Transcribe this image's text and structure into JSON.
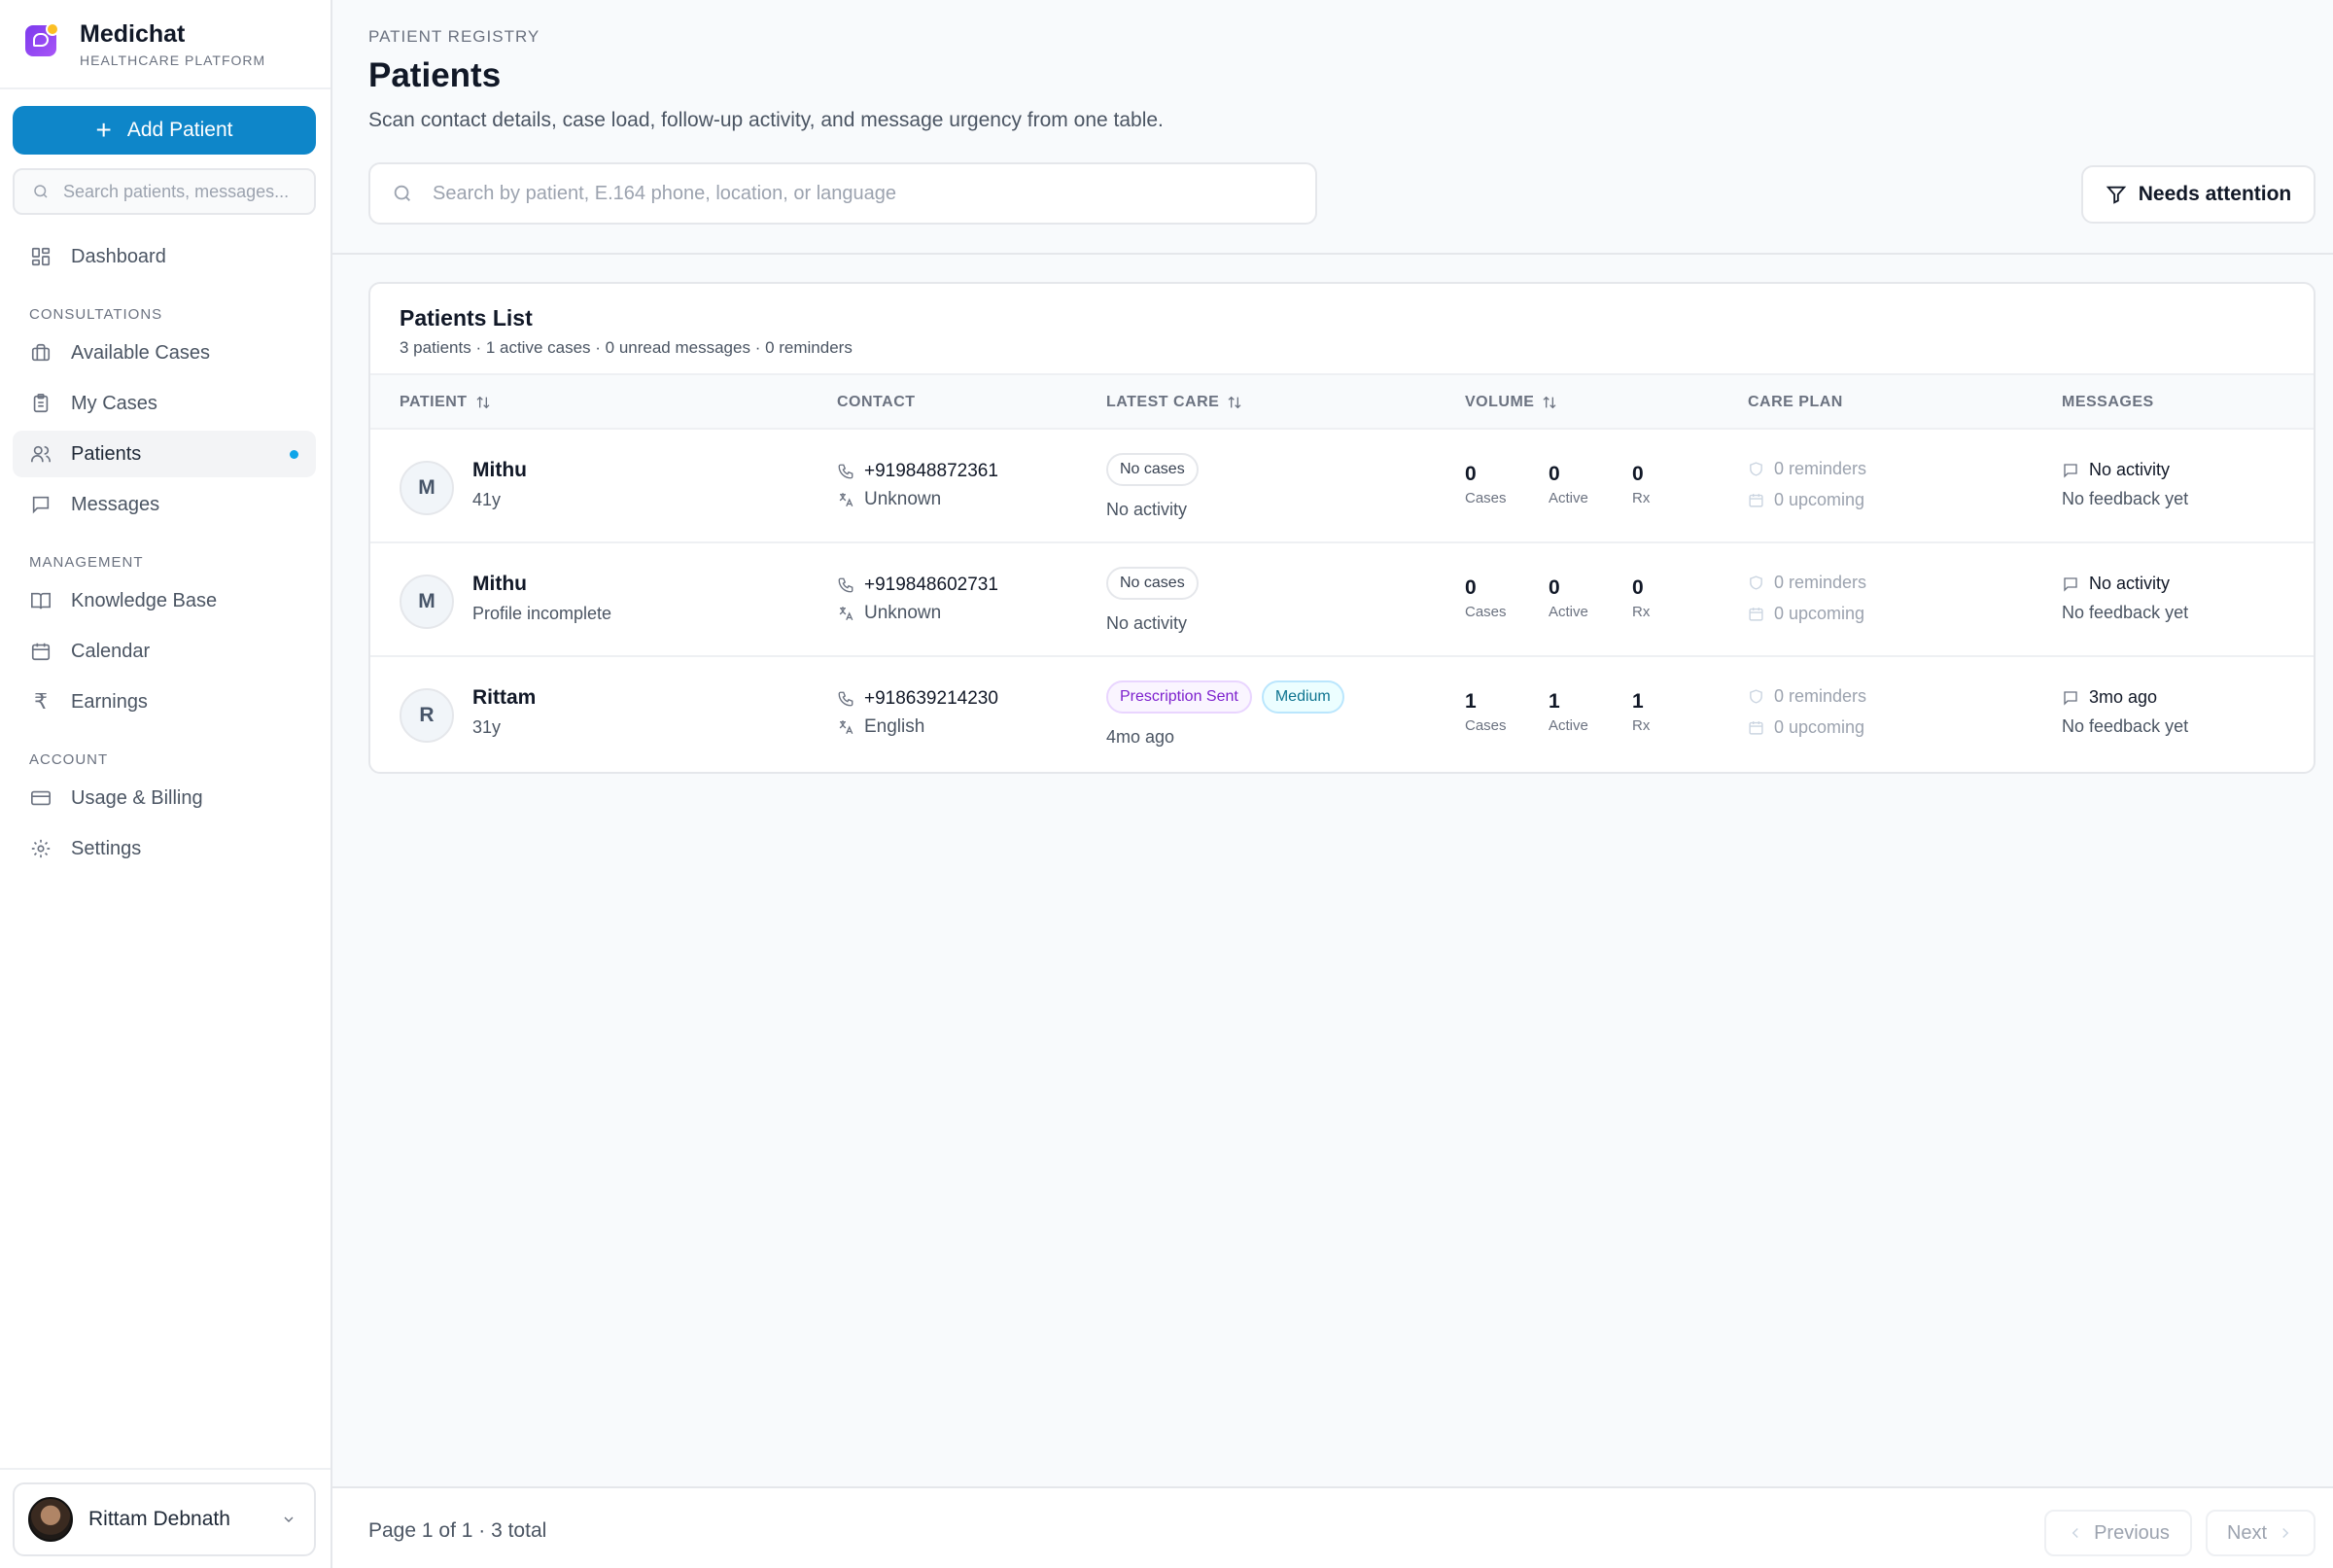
{
  "brand": {
    "name": "Medichat",
    "subtitle": "HEALTHCARE PLATFORM"
  },
  "sidebar": {
    "add_label": "Add Patient",
    "search_placeholder": "Search patients, messages...",
    "dashboard": "Dashboard",
    "sections": {
      "consultations": "CONSULTATIONS",
      "management": "MANAGEMENT",
      "account": "ACCOUNT"
    },
    "items": {
      "available_cases": "Available Cases",
      "my_cases": "My Cases",
      "patients": "Patients",
      "messages": "Messages",
      "knowledge_base": "Knowledge Base",
      "calendar": "Calendar",
      "earnings": "Earnings",
      "usage_billing": "Usage & Billing",
      "settings": "Settings"
    },
    "active_item": "Patients",
    "user_name": "Rittam Debnath"
  },
  "header": {
    "eyebrow": "PATIENT REGISTRY",
    "title": "Patients",
    "description": "Scan contact details, case load, follow-up activity, and message urgency from one table.",
    "search_placeholder": "Search by patient, E.164 phone, location, or language",
    "filter_label": "Needs attention"
  },
  "table": {
    "title": "Patients List",
    "summary": "3 patients · 1 active cases · 0 unread messages · 0 reminders",
    "columns": {
      "patient": "PATIENT",
      "contact": "CONTACT",
      "latest_care": "LATEST CARE",
      "volume": "VOLUME",
      "care_plan": "CARE PLAN",
      "messages": "MESSAGES"
    },
    "rows": [
      {
        "initial": "M",
        "name": "Mithu",
        "meta": "41y",
        "phone": "+919848872361",
        "language": "Unknown",
        "badge1": "No cases",
        "badge2": "",
        "last_care": "No activity",
        "cases": "0",
        "cases_label": "Cases",
        "active": "0",
        "active_label": "Active",
        "rx": "0",
        "rx_label": "Rx",
        "reminders": "0 reminders",
        "upcoming": "0 upcoming",
        "msg_activity": "No activity",
        "feedback": "No feedback yet"
      },
      {
        "initial": "M",
        "name": "Mithu",
        "meta": "Profile incomplete",
        "phone": "+919848602731",
        "language": "Unknown",
        "badge1": "No cases",
        "badge2": "",
        "last_care": "No activity",
        "cases": "0",
        "cases_label": "Cases",
        "active": "0",
        "active_label": "Active",
        "rx": "0",
        "rx_label": "Rx",
        "reminders": "0 reminders",
        "upcoming": "0 upcoming",
        "msg_activity": "No activity",
        "feedback": "No feedback yet"
      },
      {
        "initial": "R",
        "name": "Rittam",
        "meta": "31y",
        "phone": "+918639214230",
        "language": "English",
        "badge1": "Prescription Sent",
        "badge2": "Medium",
        "last_care": "4mo ago",
        "cases": "1",
        "cases_label": "Cases",
        "active": "1",
        "active_label": "Active",
        "rx": "1",
        "rx_label": "Rx",
        "reminders": "0 reminders",
        "upcoming": "0 upcoming",
        "msg_activity": "3mo ago",
        "feedback": "No feedback yet"
      }
    ]
  },
  "pagination": {
    "info": "Page 1 of 1 · 3 total",
    "prev": "Previous",
    "next": "Next"
  },
  "colors": {
    "primary": "#0e86c9",
    "active_dot": "#0ea5e9",
    "rx_badge": "#7e22ce",
    "medium_badge": "#0e7490"
  }
}
